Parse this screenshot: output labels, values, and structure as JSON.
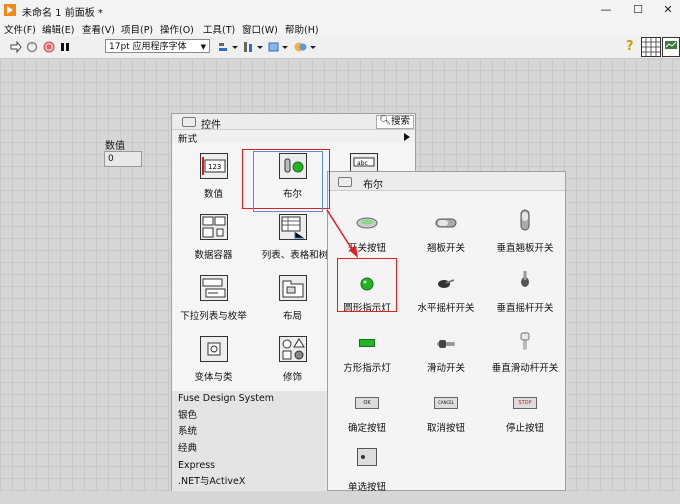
{
  "window": {
    "title": "未命名 1 前面板 *",
    "min": "—",
    "max": "☐",
    "close": "✕"
  },
  "menu": [
    "文件(F)",
    "编辑(E)",
    "查看(V)",
    "项目(P)",
    "操作(O)",
    "工具(T)",
    "窗口(W)",
    "帮助(H)"
  ],
  "toolbar": {
    "font": "17pt 应用程序字体",
    "help": "?"
  },
  "front_panel": {
    "num_label": "数值",
    "num_value": "0"
  },
  "palette": {
    "title": "控件",
    "search": "搜索",
    "category": "新式",
    "items": [
      "数值",
      "布尔",
      "数据容器",
      "列表、表格和树",
      "下拉列表与枚举",
      "布局",
      "变体与类",
      "修饰"
    ],
    "list": [
      "Fuse Design System",
      "银色",
      "系统",
      "经典",
      "Express",
      ".NET与ActiveX"
    ]
  },
  "bool_palette": {
    "title": "布尔",
    "items": [
      "开关按钮",
      "翘板开关",
      "垂直翘板开关",
      "圆形指示灯",
      "水平摇杆开关",
      "垂直摇杆开关",
      "方形指示灯",
      "滑动开关",
      "垂直滑动杆开关",
      "确定按钮",
      "取消按钮",
      "停止按钮",
      "单选按钮"
    ],
    "button_text": {
      "ok": "OK",
      "cancel": "CANCEL",
      "stop": "STOP"
    }
  },
  "colors": {
    "highlight": "#e02020",
    "led_green": "#22b422",
    "title_icon": "#f08a1c"
  }
}
